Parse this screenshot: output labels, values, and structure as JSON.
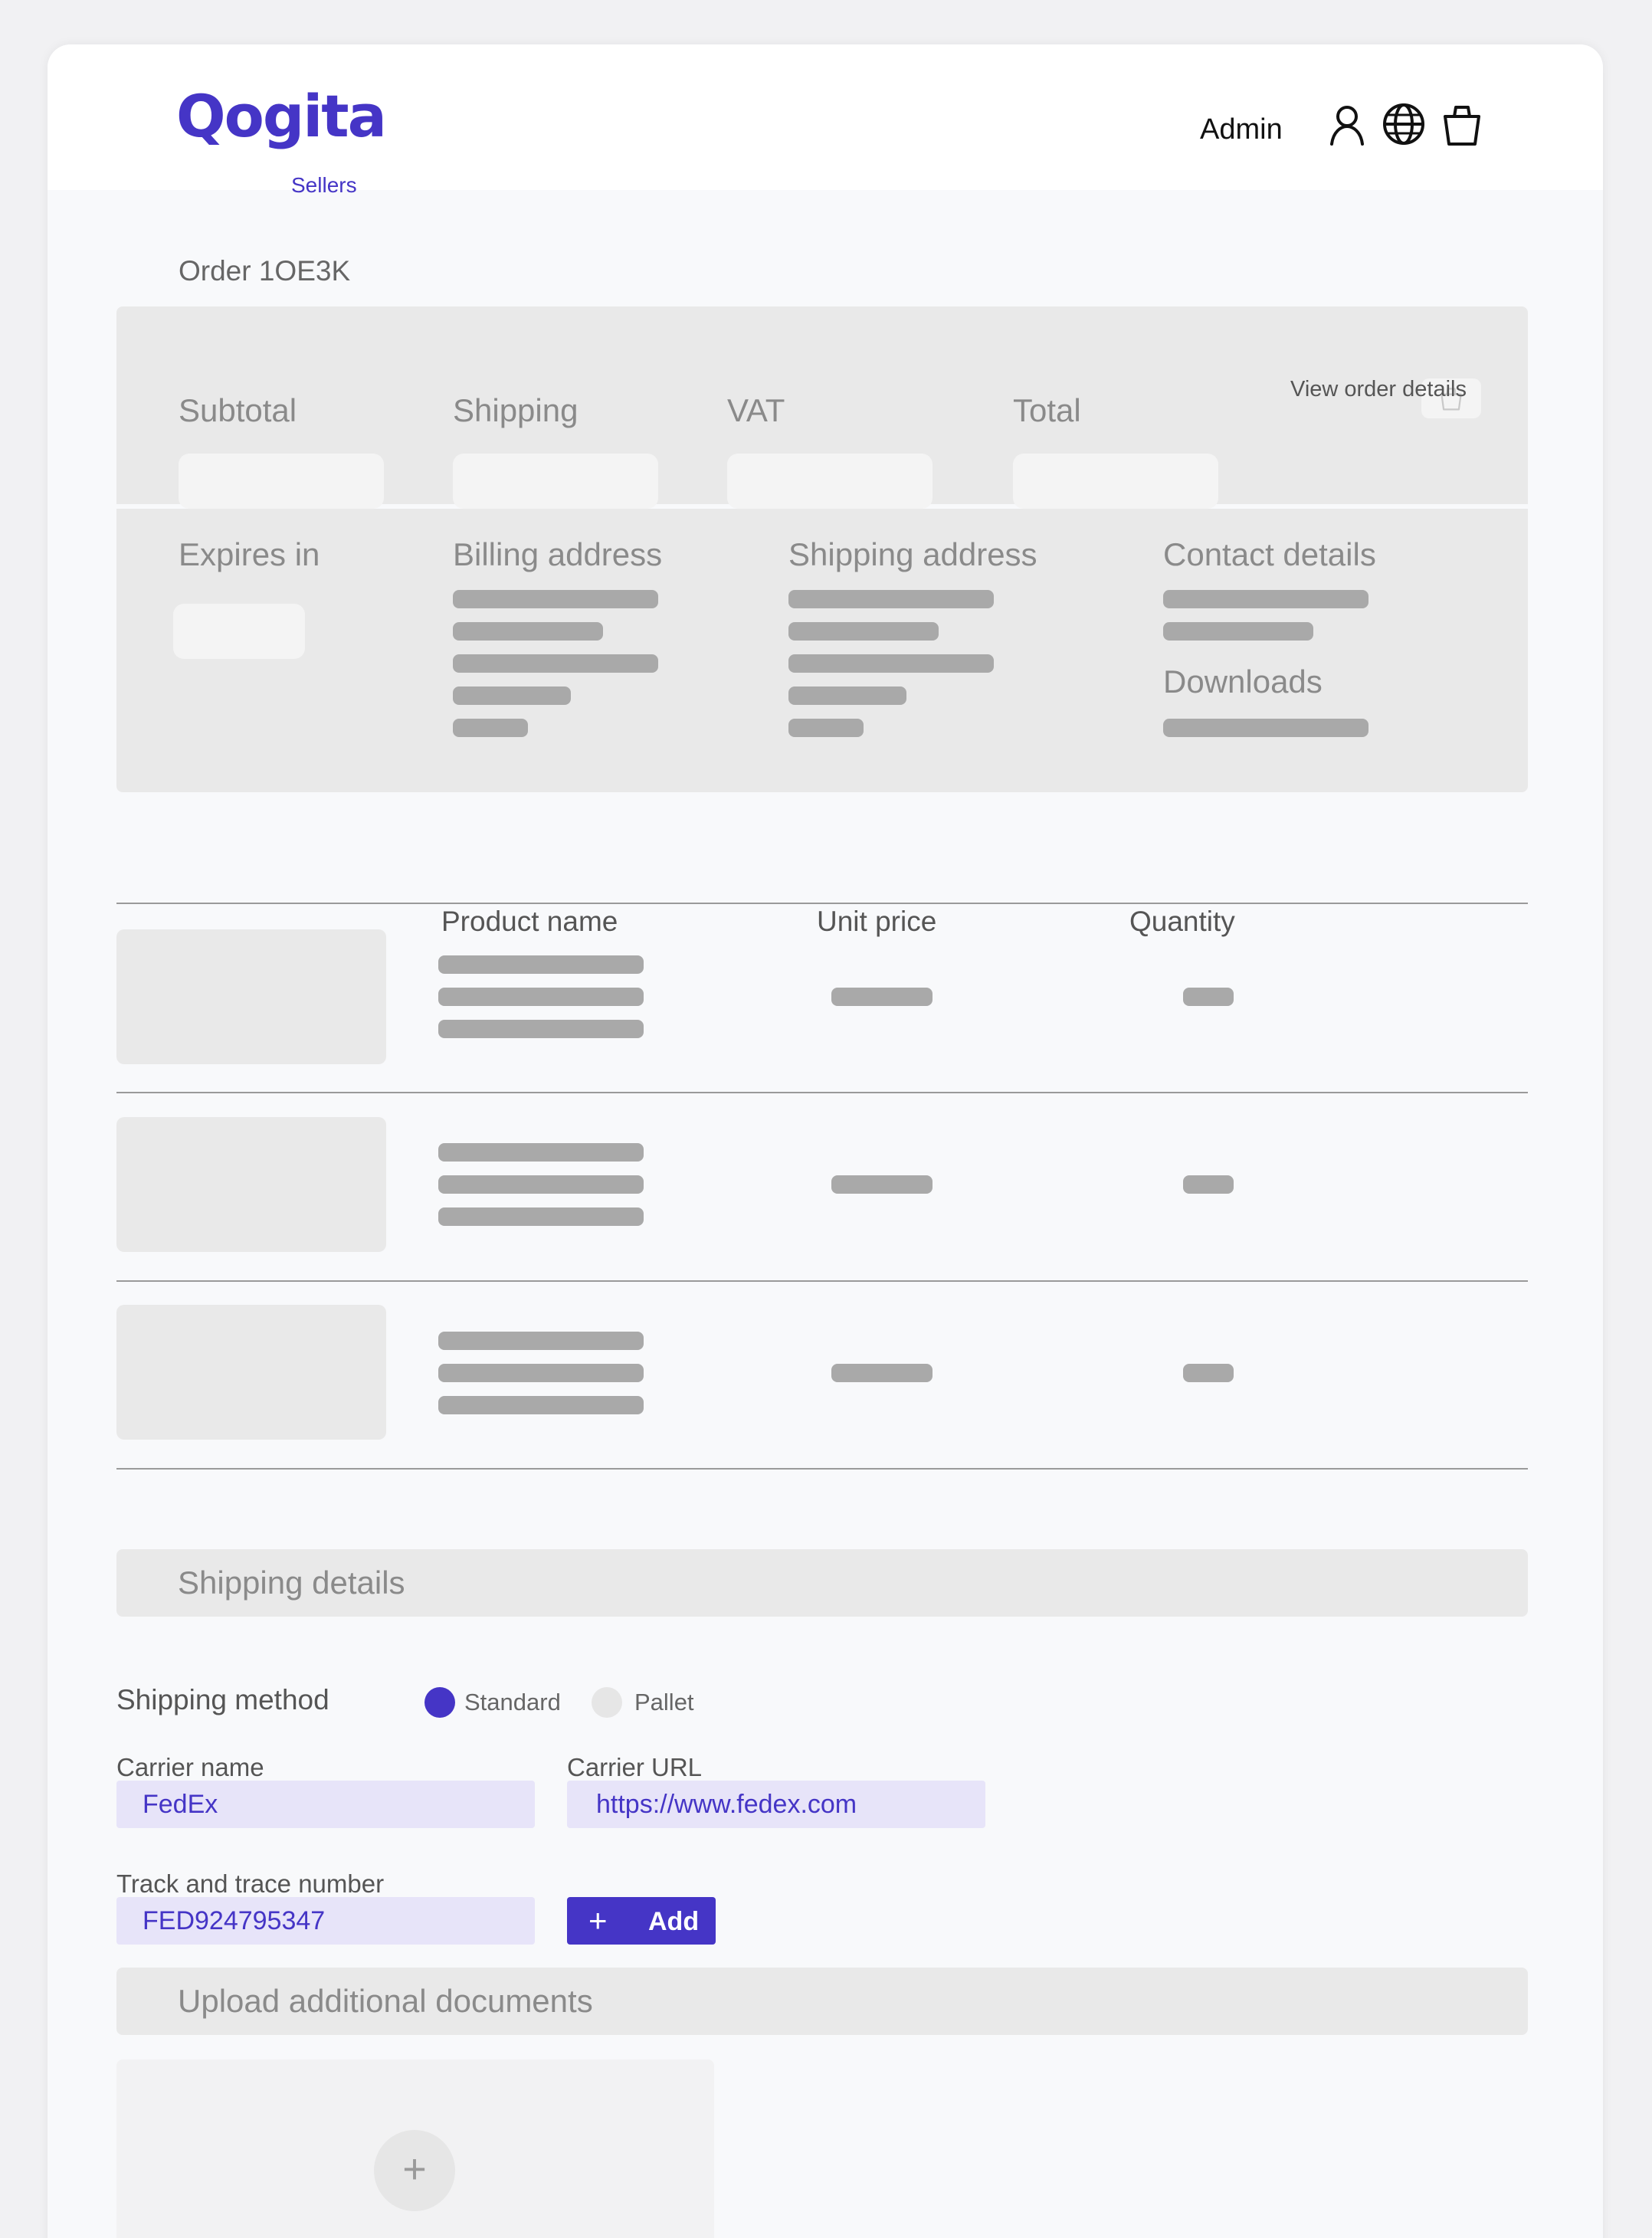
{
  "header": {
    "logo_text": "Qogita",
    "logo_sub": "Sellers",
    "user_label": "Admin",
    "icons": [
      "user-icon",
      "globe-icon",
      "shopping-bag-icon"
    ]
  },
  "order": {
    "title": "Order 1OE3K",
    "summary_labels": {
      "subtotal": "Subtotal",
      "shipping": "Shipping",
      "vat": "VAT",
      "total": "Total"
    },
    "view_details_label": "View order details",
    "expires_label": "Expires in",
    "billing_label": "Billing address",
    "shipping_address_label": "Shipping address",
    "contact_label": "Contact details",
    "downloads_label": "Downloads"
  },
  "table": {
    "columns": [
      "Product name",
      "Unit price",
      "Quantity"
    ],
    "row_count": 3
  },
  "shipping_details": {
    "section_title": "Shipping details",
    "method_label": "Shipping method",
    "options": [
      {
        "label": "Standard",
        "selected": true
      },
      {
        "label": "Pallet",
        "selected": false
      }
    ],
    "carrier_name_label": "Carrier name",
    "carrier_name_value": "FedEx",
    "carrier_url_label": "Carrier URL",
    "carrier_url_value": "https://www.fedex.com",
    "tracking_label": "Track and trace number",
    "tracking_value": "FED924795347",
    "add_button_label": "Add",
    "add_button_icon": "plus-icon"
  },
  "upload": {
    "section_title": "Upload additional documents",
    "upload_icon": "plus-icon"
  },
  "colors": {
    "brand": "#4535c6",
    "input_fill": "#e7e4f9",
    "skeleton": "#a9a9a9",
    "panel": "#e9e9e9"
  }
}
